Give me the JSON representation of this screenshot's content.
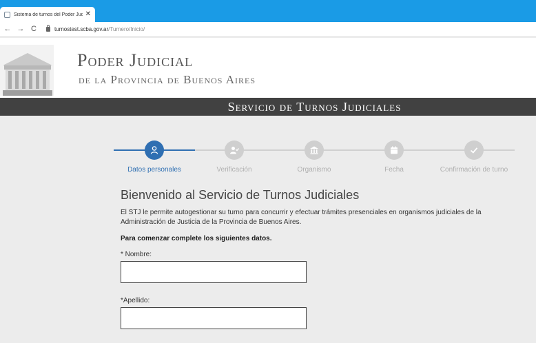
{
  "browser": {
    "tab_title": "Sistema de turnos del Poder Judic",
    "close_glyph": "✕",
    "back_glyph": "←",
    "forward_glyph": "→",
    "reload_glyph": "C",
    "url_host": "turnostest.scba.gov.ar",
    "url_path": "/Turnero/Inicio/"
  },
  "header": {
    "title": "Poder Judicial",
    "subtitle": "de la Provincia de Buenos Aires",
    "service_title": "Servicio de Turnos Judiciales"
  },
  "stepper": {
    "steps": [
      {
        "label": "Datos personales",
        "icon": "person-icon",
        "active": true
      },
      {
        "label": "Verificación",
        "icon": "user-check-icon",
        "active": false
      },
      {
        "label": "Organismo",
        "icon": "building-icon",
        "active": false
      },
      {
        "label": "Fecha",
        "icon": "calendar-icon",
        "active": false
      },
      {
        "label": "Confirmación de turno",
        "icon": "check-icon",
        "active": false
      }
    ]
  },
  "content": {
    "welcome": "Bienvenido al Servicio de Turnos Judiciales",
    "intro_line1": "El STJ le permite autogestionar su turno para concurrir y efectuar trámites presenciales en organismos judiciales de la",
    "intro_line2": "Administración de Justicia de la Provincia de Buenos Aires.",
    "instruction": "Para comenzar complete los siguientes datos."
  },
  "form": {
    "nombre_label": "* Nombre:",
    "nombre_value": "",
    "apellido_label": "*Apellido:",
    "apellido_value": ""
  },
  "colors": {
    "accent": "#2f6fb2",
    "tabbar": "#1a9be6",
    "service_bar": "#414141"
  }
}
